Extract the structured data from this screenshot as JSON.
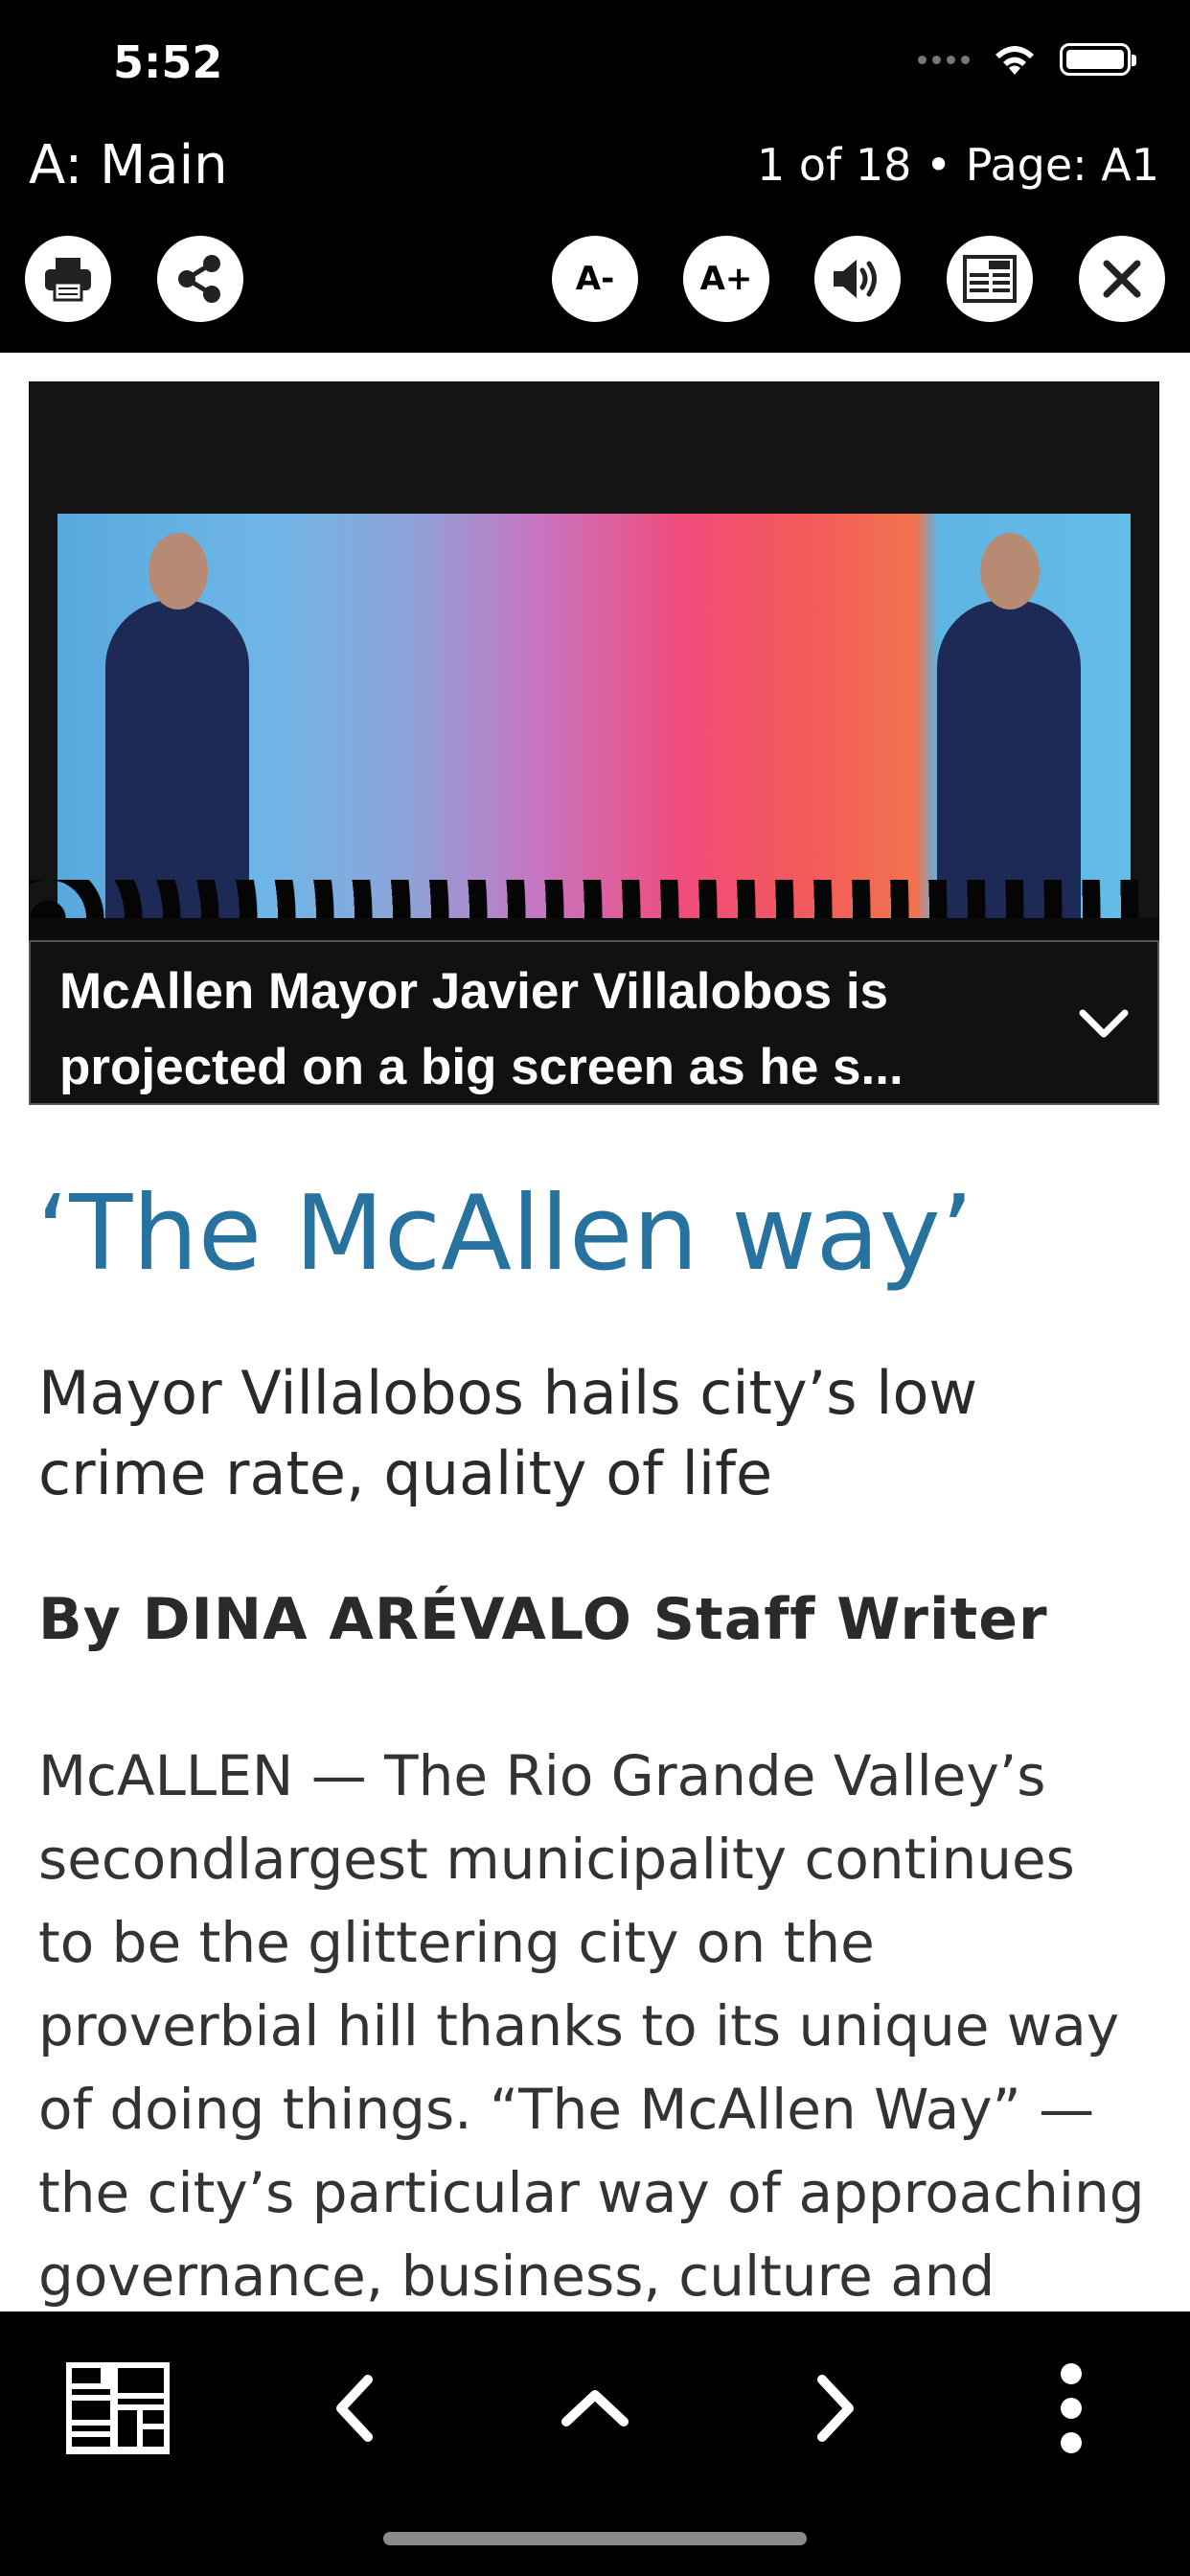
{
  "status_bar": {
    "time": "5:52",
    "icons": [
      "signal-icon",
      "wifi-icon",
      "battery-icon"
    ]
  },
  "header": {
    "section_title": "A: Main",
    "page_info": "1 of 18 • Page: A1"
  },
  "toolbar": {
    "buttons": [
      {
        "name": "print",
        "icon": "printer-icon"
      },
      {
        "name": "share",
        "icon": "share-icon"
      },
      {
        "name": "decrease-font",
        "label": "A-"
      },
      {
        "name": "increase-font",
        "label": "A+"
      },
      {
        "name": "read-aloud",
        "icon": "speaker-icon"
      },
      {
        "name": "newspaper-view",
        "icon": "newspaper-icon"
      },
      {
        "name": "close",
        "icon": "close-icon"
      }
    ]
  },
  "photo": {
    "caption": "McAllen Mayor Javier Villalobos is\nprojected on a big screen as he s..."
  },
  "article": {
    "headline": "‘The McAllen way’",
    "subhead": "Mayor Villalobos hails city’s low crime rate, quality of life",
    "byline": "By DINA ARÉVALO Staff Writer",
    "body_lines": [
      "McALLEN — The Rio Grande Valley’s",
      "secondlargest municipality continues",
      "to be the glittering city on the",
      "proverbial hill thanks to its unique way",
      "of doing things. “The McAllen Way” —",
      "the city’s particular way of approaching",
      "governance, business, culture and"
    ]
  },
  "bottom_nav": {
    "items": [
      "newspaper-icon",
      "chevron-left-icon",
      "chevron-up-icon",
      "chevron-right-icon",
      "more-vertical-icon"
    ]
  },
  "colors": {
    "headline": "#27729e",
    "bars": "#000000"
  }
}
